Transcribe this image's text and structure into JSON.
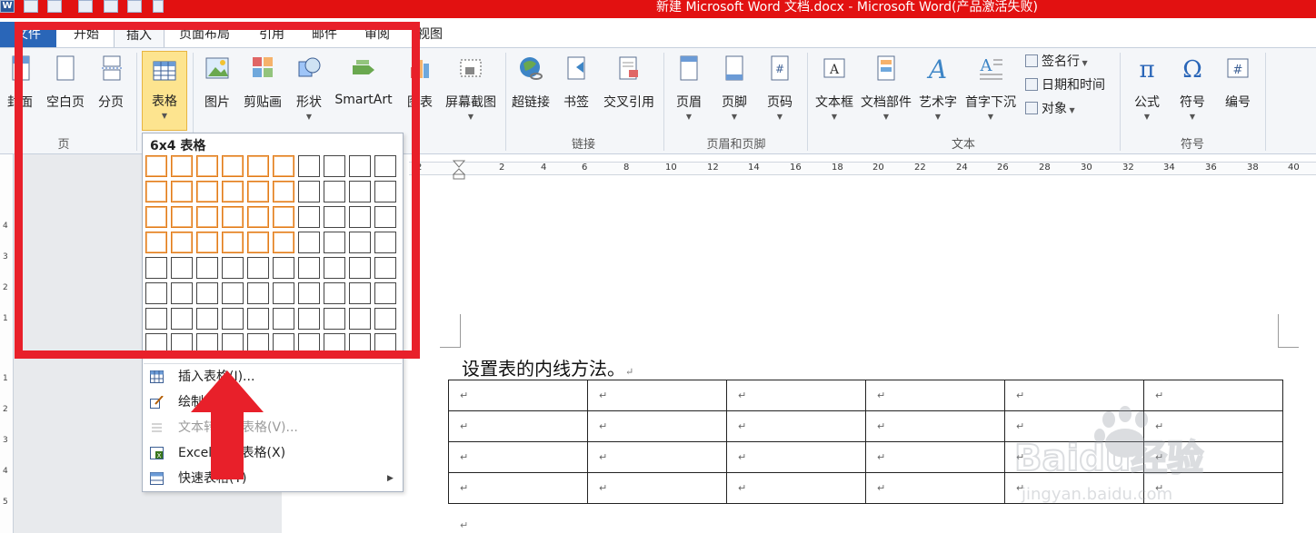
{
  "titlebar": {
    "title": "新建 Microsoft Word 文档.docx - Microsoft Word(产品激活失败)",
    "color": "#e21111",
    "app_icon": "W"
  },
  "tabs": [
    {
      "label": "文件",
      "active": false
    },
    {
      "label": "开始",
      "active": false
    },
    {
      "label": "插入",
      "active": true
    },
    {
      "label": "页面布局",
      "active": false
    },
    {
      "label": "引用",
      "active": false
    },
    {
      "label": "邮件",
      "active": false
    },
    {
      "label": "审阅",
      "active": false
    },
    {
      "label": "视图",
      "active": false
    }
  ],
  "ribbon": {
    "groups": [
      {
        "label": "页",
        "buttons": [
          "封面",
          "空白页",
          "分页"
        ]
      },
      {
        "label": "",
        "buttons": [
          "表格"
        ]
      },
      {
        "label": "",
        "buttons": [
          "图片",
          "剪贴画",
          "形状",
          "SmartArt",
          "图表",
          "屏幕截图"
        ]
      },
      {
        "label": "链接",
        "buttons": [
          "超链接",
          "书签",
          "交叉引用"
        ]
      },
      {
        "label": "页眉和页脚",
        "buttons": [
          "页眉",
          "页脚",
          "页码"
        ]
      },
      {
        "label": "文本",
        "buttons": [
          "文本框",
          "文档部件",
          "艺术字",
          "首字下沉"
        ],
        "small_buttons": [
          "签名行",
          "日期和时间",
          "对象"
        ]
      },
      {
        "label": "符号",
        "buttons": [
          "公式",
          "符号",
          "编号"
        ]
      }
    ]
  },
  "table_dropdown": {
    "title": "6x4 表格",
    "grid_cols": 10,
    "grid_rows": 8,
    "selected_cols": 6,
    "selected_rows": 4,
    "selection_color": "#e07b1a",
    "menu": [
      {
        "label": "插入表格(I)...",
        "icon": "insert-table-icon",
        "disabled": false,
        "submenu": false
      },
      {
        "label": "绘制表格(D)",
        "icon": "draw-table-icon",
        "disabled": false,
        "submenu": false
      },
      {
        "label": "文本转换成表格(V)...",
        "icon": "text-to-table-icon",
        "disabled": true,
        "submenu": false
      },
      {
        "label": "Excel 电子表格(X)",
        "icon": "excel-icon",
        "disabled": false,
        "submenu": false
      },
      {
        "label": "快速表格(T)",
        "icon": "quick-table-icon",
        "disabled": false,
        "submenu": true
      }
    ]
  },
  "ruler": {
    "labels": [
      "2",
      "2",
      "4",
      "6",
      "8",
      "10",
      "12",
      "14",
      "16",
      "18",
      "20",
      "22",
      "24",
      "26",
      "28",
      "30",
      "32",
      "34",
      "36",
      "38",
      "40"
    ]
  },
  "vertical_ruler": {
    "labels": [
      "4",
      "3",
      "2",
      "1",
      "1",
      "2",
      "3",
      "4",
      "5"
    ]
  },
  "document": {
    "paragraph": "设置表的内线方法。",
    "paragraph_mark": "↵",
    "table_rows": 4,
    "table_cols": 6
  },
  "watermark": {
    "logo_text": "Baidu经验",
    "url": "jingyan.baidu.com"
  },
  "annotation": {
    "box_color": "#e8202a",
    "arrow_color": "#e8202a"
  }
}
